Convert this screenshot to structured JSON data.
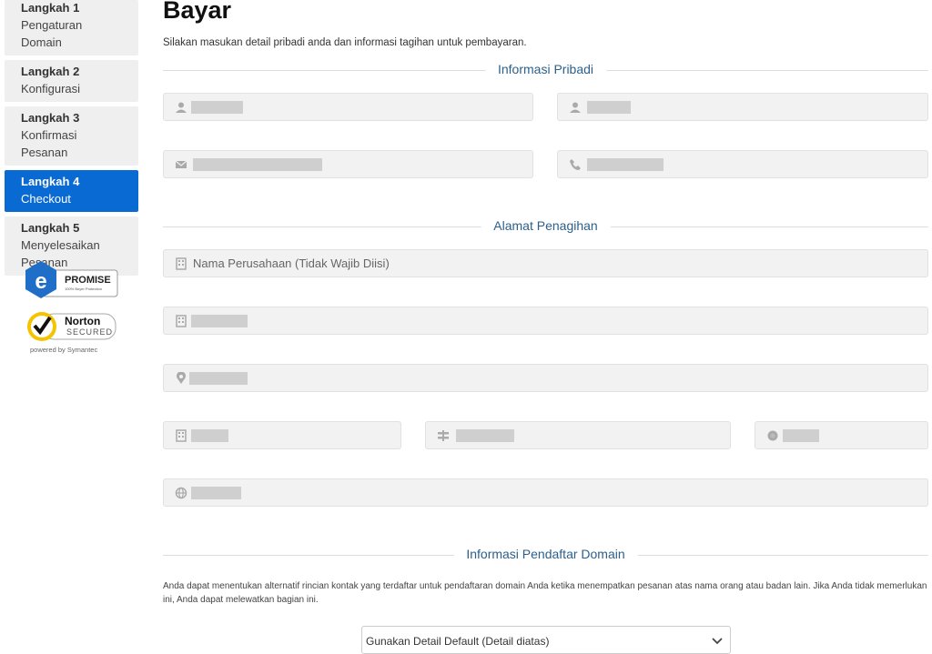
{
  "steps": [
    {
      "title": "Langkah 1",
      "desc": "Pengaturan Domain",
      "active": false
    },
    {
      "title": "Langkah 2",
      "desc": "Konfigurasi",
      "active": false
    },
    {
      "title": "Langkah 3",
      "desc": "Konfirmasi Pesanan",
      "active": false
    },
    {
      "title": "Langkah 4",
      "desc": "Checkout",
      "active": true
    },
    {
      "title": "Langkah 5",
      "desc": "Menyelesaikan Pesanan",
      "active": false
    }
  ],
  "badges": {
    "epromise": {
      "title": "PROMISE",
      "sub": "100% Buyer Protection"
    },
    "norton": {
      "title": "Norton",
      "sub": "SECURED",
      "powered": "powered by Symantec"
    }
  },
  "page": {
    "title": "Bayar",
    "intro": "Silakan masukan detail pribadi anda dan informasi tagihan untuk pembayaran."
  },
  "sections": {
    "personal": "Informasi Pribadi",
    "billing": "Alamat Penagihan",
    "registrant": "Informasi Pendaftar Domain"
  },
  "fields": {
    "company_placeholder": "Nama Perusahaan (Tidak Wajib Diisi)"
  },
  "registrant": {
    "note": "Anda dapat menentukan alternatif rincian kontak yang terdaftar untuk pendaftaran domain Anda ketika menempatkan pesanan atas nama orang atau badan lain. Jika Anda tidak memerlukan ini, Anda dapat melewatkan bagian ini.",
    "select_value": "Gunakan Detail Default (Detail diatas)"
  },
  "colors": {
    "accent": "#0a6ad4",
    "section_title": "#2b5f8c"
  }
}
